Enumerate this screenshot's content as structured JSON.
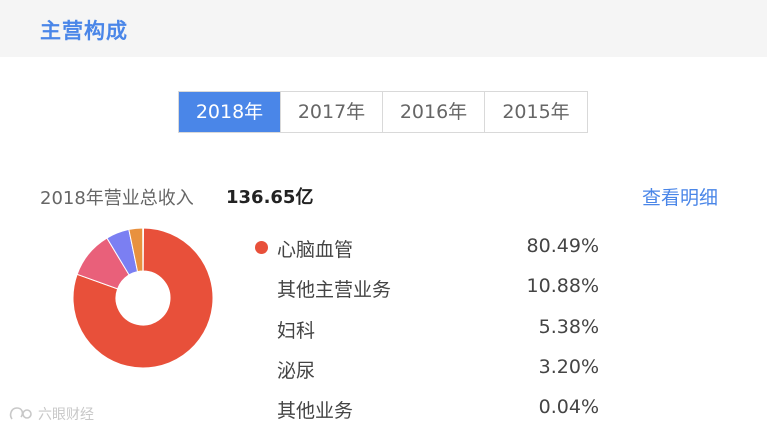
{
  "header": {
    "title": "主营构成"
  },
  "year_tabs": [
    {
      "label": "2018年",
      "active": true
    },
    {
      "label": "2017年",
      "active": false
    },
    {
      "label": "2016年",
      "active": false
    },
    {
      "label": "2015年",
      "active": false
    }
  ],
  "revenue": {
    "label": "2018年营业总收入",
    "value": "136.65亿"
  },
  "details_link": "查看明细",
  "chart_data": {
    "type": "pie",
    "categories": [
      "心脑血管",
      "其他主营业务",
      "妇科",
      "泌尿",
      "其他业务"
    ],
    "values": [
      80.49,
      10.88,
      5.38,
      3.2,
      0.04
    ],
    "labels": [
      "80.49%",
      "10.88%",
      "5.38%",
      "3.20%",
      "0.04%"
    ],
    "colors": [
      "#e8503a",
      "#e9607a",
      "#7b7ff2",
      "#e8913e",
      "#555555"
    ],
    "title": "",
    "legend": "right"
  },
  "selected_legend_index": 0,
  "watermark": {
    "icon": "logo-icon",
    "text": "六眼财经"
  }
}
